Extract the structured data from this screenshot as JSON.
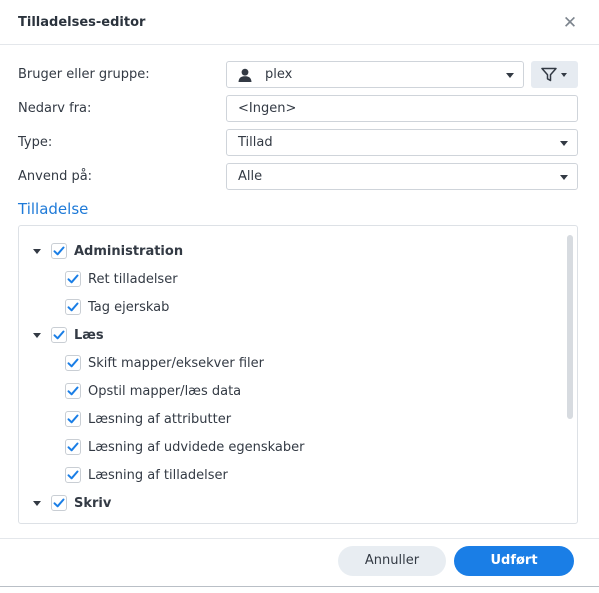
{
  "dialog": {
    "title": "Tilladelses-editor",
    "close_glyph": "✕"
  },
  "form": {
    "user_label": "Bruger eller gruppe:",
    "user_value": "plex",
    "inherit_label": "Nedarv fra:",
    "inherit_value": "<Ingen>",
    "type_label": "Type:",
    "type_value": "Tillad",
    "apply_label": "Anvend på:",
    "apply_value": "Alle"
  },
  "permissions": {
    "section_title": "Tilladelse",
    "groups": [
      {
        "label": "Administration",
        "checked": true,
        "expanded": true,
        "items": [
          {
            "label": "Ret tilladelser",
            "checked": true
          },
          {
            "label": "Tag ejerskab",
            "checked": true
          }
        ]
      },
      {
        "label": "Læs",
        "checked": true,
        "expanded": true,
        "items": [
          {
            "label": "Skift mapper/eksekver filer",
            "checked": true
          },
          {
            "label": "Opstil mapper/læs data",
            "checked": true
          },
          {
            "label": "Læsning af attributter",
            "checked": true
          },
          {
            "label": "Læsning af udvidede egenskaber",
            "checked": true
          },
          {
            "label": "Læsning af tilladelser",
            "checked": true
          }
        ]
      },
      {
        "label": "Skriv",
        "checked": true,
        "expanded": true,
        "items": []
      }
    ]
  },
  "footer": {
    "cancel_label": "Annuller",
    "ok_label": "Udført"
  },
  "colors": {
    "accent": "#1a7ee6",
    "section_title": "#1e7ad8",
    "checkmark": "#1a7ee6"
  },
  "icons": {
    "user": "user-icon",
    "filter": "filter-icon",
    "close": "close-icon",
    "dropdown": "chevron-down-icon",
    "expander": "caret-down-icon",
    "check": "checkmark-icon"
  }
}
